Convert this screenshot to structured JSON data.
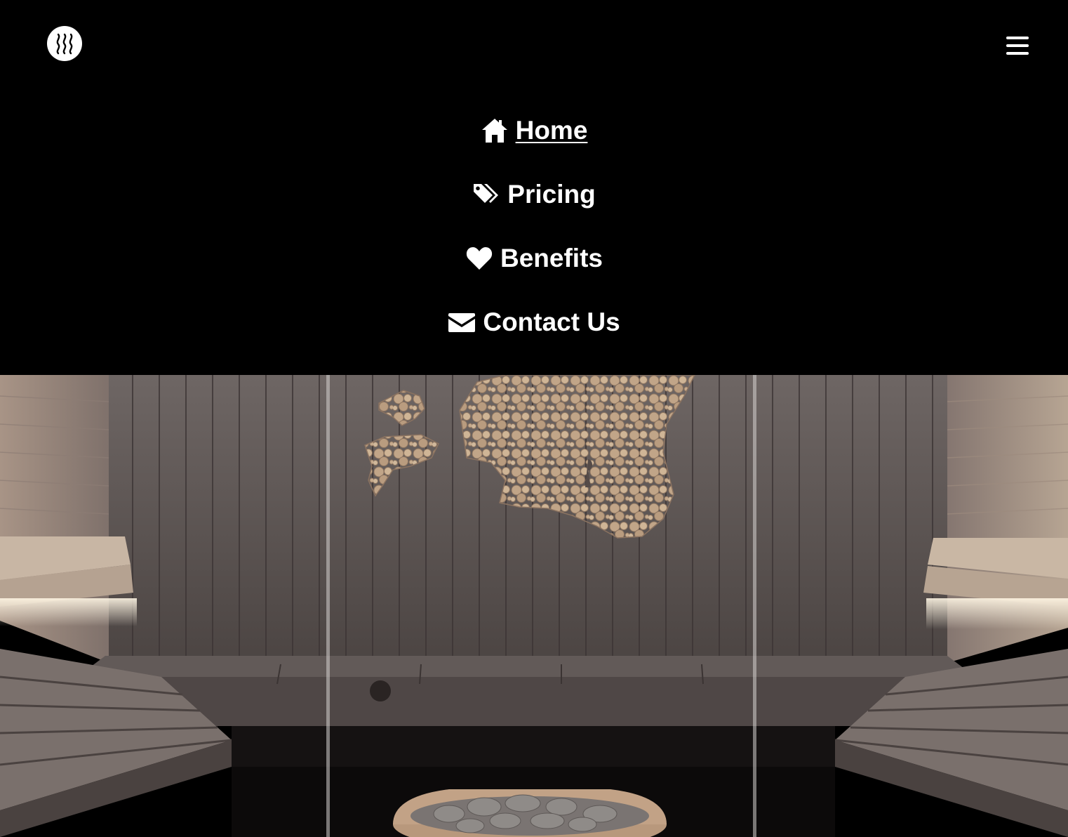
{
  "header": {
    "logo_icon": "steam-icon",
    "menu_icon": "hamburger-menu-icon"
  },
  "nav": {
    "items": [
      {
        "label": " Home",
        "icon": "home-icon",
        "active": true
      },
      {
        "label": " Pricing",
        "icon": "tags-icon",
        "active": false
      },
      {
        "label": " Benefits",
        "icon": "heart-icon",
        "active": false
      },
      {
        "label": " Contact Us",
        "icon": "envelope-icon",
        "active": false
      }
    ]
  },
  "hero": {
    "image": "sauna-interior-photo"
  },
  "colors": {
    "background": "#000000",
    "text": "#ffffff",
    "wood_dark": "#5e5654",
    "wood_light": "#b9a58f"
  }
}
